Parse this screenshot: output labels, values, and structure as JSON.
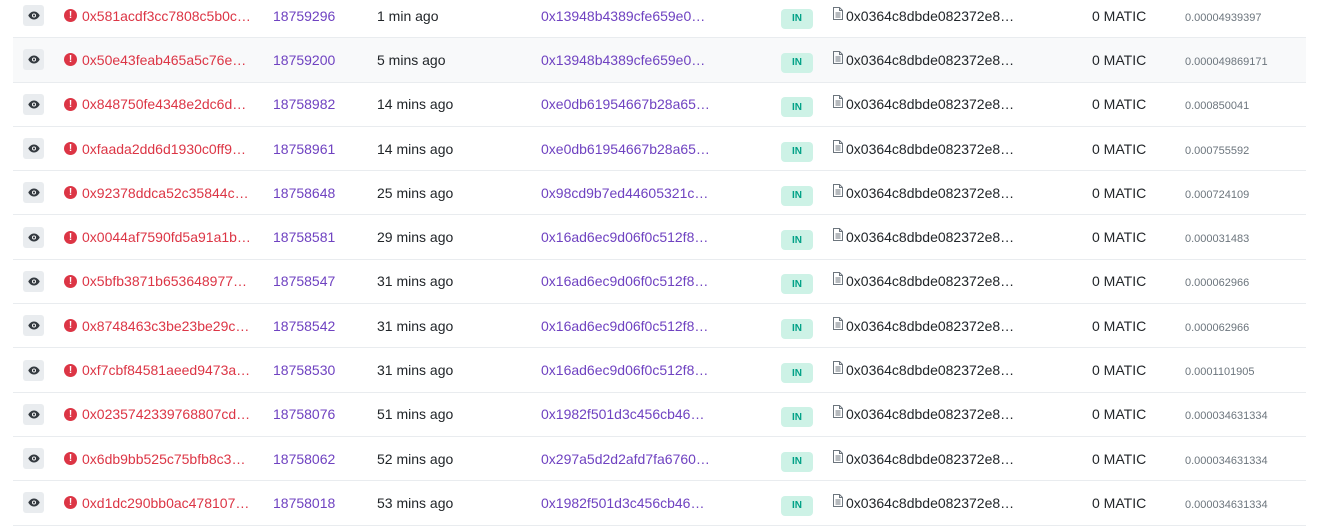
{
  "rows": [
    {
      "hash": "0x581acdf3cc7808c5b0c…",
      "block": "18759296",
      "age": "1 min ago",
      "from": "0x13948b4389cfe659e0…",
      "dir": "IN",
      "to": "0x0364c8dbde082372e8…",
      "value": "0 MATIC",
      "fee": "0.00004939397"
    },
    {
      "hash": "0x50e43feab465a5c76e…",
      "block": "18759200",
      "age": "5 mins ago",
      "from": "0x13948b4389cfe659e0…",
      "dir": "IN",
      "to": "0x0364c8dbde082372e8…",
      "value": "0 MATIC",
      "fee": "0.000049869171"
    },
    {
      "hash": "0x848750fe4348e2dc6d…",
      "block": "18758982",
      "age": "14 mins ago",
      "from": "0xe0db61954667b28a65…",
      "dir": "IN",
      "to": "0x0364c8dbde082372e8…",
      "value": "0 MATIC",
      "fee": "0.000850041"
    },
    {
      "hash": "0xfaada2dd6d1930c0ff9…",
      "block": "18758961",
      "age": "14 mins ago",
      "from": "0xe0db61954667b28a65…",
      "dir": "IN",
      "to": "0x0364c8dbde082372e8…",
      "value": "0 MATIC",
      "fee": "0.000755592"
    },
    {
      "hash": "0x92378ddca52c35844c…",
      "block": "18758648",
      "age": "25 mins ago",
      "from": "0x98cd9b7ed44605321c…",
      "dir": "IN",
      "to": "0x0364c8dbde082372e8…",
      "value": "0 MATIC",
      "fee": "0.000724109"
    },
    {
      "hash": "0x0044af7590fd5a91a1b…",
      "block": "18758581",
      "age": "29 mins ago",
      "from": "0x16ad6ec9d06f0c512f8…",
      "dir": "IN",
      "to": "0x0364c8dbde082372e8…",
      "value": "0 MATIC",
      "fee": "0.000031483"
    },
    {
      "hash": "0x5bfb3871b653648977…",
      "block": "18758547",
      "age": "31 mins ago",
      "from": "0x16ad6ec9d06f0c512f8…",
      "dir": "IN",
      "to": "0x0364c8dbde082372e8…",
      "value": "0 MATIC",
      "fee": "0.000062966"
    },
    {
      "hash": "0x8748463c3be23be29c…",
      "block": "18758542",
      "age": "31 mins ago",
      "from": "0x16ad6ec9d06f0c512f8…",
      "dir": "IN",
      "to": "0x0364c8dbde082372e8…",
      "value": "0 MATIC",
      "fee": "0.000062966"
    },
    {
      "hash": "0xf7cbf84581aeed9473a…",
      "block": "18758530",
      "age": "31 mins ago",
      "from": "0x16ad6ec9d06f0c512f8…",
      "dir": "IN",
      "to": "0x0364c8dbde082372e8…",
      "value": "0 MATIC",
      "fee": "0.0001101905"
    },
    {
      "hash": "0x0235742339768807cd…",
      "block": "18758076",
      "age": "51 mins ago",
      "from": "0x1982f501d3c456cb46…",
      "dir": "IN",
      "to": "0x0364c8dbde082372e8…",
      "value": "0 MATIC",
      "fee": "0.000034631334"
    },
    {
      "hash": "0x6db9bb525c75bfb8c3…",
      "block": "18758062",
      "age": "52 mins ago",
      "from": "0x297a5d2d2afd7fa6760…",
      "dir": "IN",
      "to": "0x0364c8dbde082372e8…",
      "value": "0 MATIC",
      "fee": "0.000034631334"
    },
    {
      "hash": "0xd1dc290bb0ac478107…",
      "block": "18758018",
      "age": "53 mins ago",
      "from": "0x1982f501d3c456cb46…",
      "dir": "IN",
      "to": "0x0364c8dbde082372e8…",
      "value": "0 MATIC",
      "fee": "0.000034631334"
    }
  ],
  "highlighted_row": 1,
  "icons": {
    "view": "eye-icon",
    "status": "error-icon",
    "contract": "document-icon"
  },
  "colors": {
    "link": "#6f42c1",
    "error": "#dc3545",
    "in_badge_bg": "#cdf2e6",
    "in_badge_text": "#00a186",
    "fee": "#6c757d"
  }
}
